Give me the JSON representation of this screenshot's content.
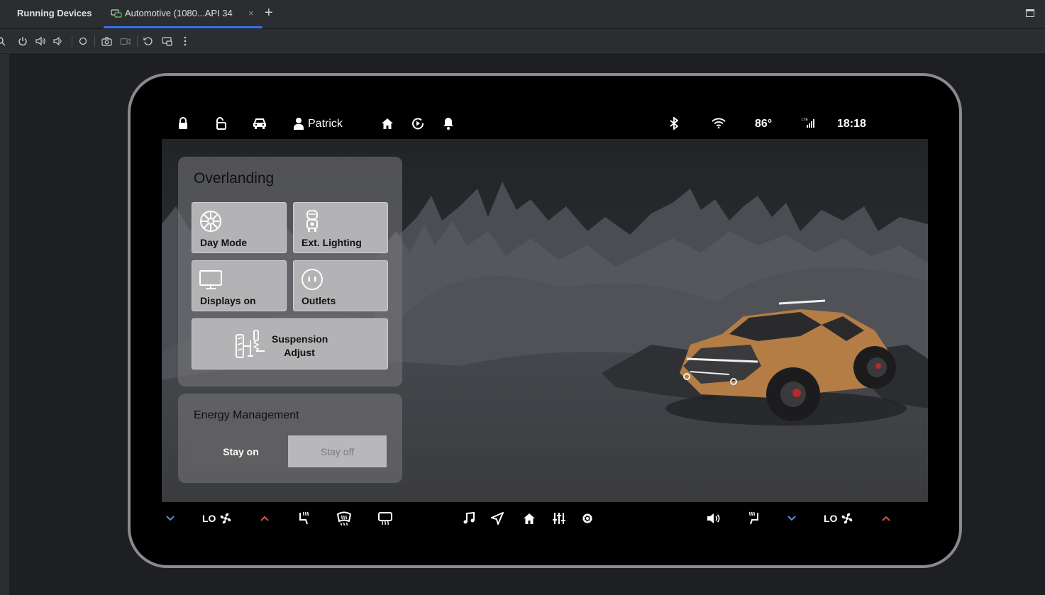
{
  "ide": {
    "panel_title": "Running Devices",
    "device_tab_label": "Automotive (1080...API 34",
    "close_glyph": "×",
    "add_glyph": "+"
  },
  "status_bar": {
    "user_name": "Patrick",
    "temperature": "86°",
    "network_label": "LTE",
    "time": "18:18"
  },
  "overlanding": {
    "title": "Overlanding",
    "tiles": [
      {
        "label": "Day Mode",
        "icon": "day-mode-icon"
      },
      {
        "label": "Ext. Lighting",
        "icon": "ext-lighting-icon"
      },
      {
        "label": "Displays on",
        "icon": "monitor-icon"
      },
      {
        "label": "Outlets",
        "icon": "outlet-icon"
      }
    ],
    "suspension_label": "Suspension Adjust"
  },
  "energy": {
    "title": "Energy Management",
    "options": [
      "Stay on",
      "Stay off"
    ],
    "selected": "Stay on"
  },
  "nav_bar": {
    "left_fan_level": "LO",
    "right_fan_level": "LO"
  },
  "colors": {
    "accent": "#3574f0",
    "temp_down": "#5c8fd6",
    "temp_up": "#e0523a",
    "truck": "#b37d45"
  }
}
